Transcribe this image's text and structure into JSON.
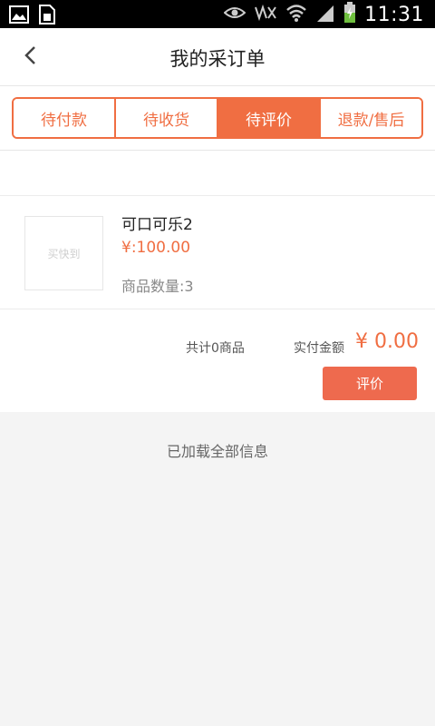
{
  "status_bar": {
    "time": "11:31",
    "icons": [
      "image-icon",
      "sim-card-icon",
      "eye-icon",
      "mute-icon",
      "wifi-icon",
      "signal-icon",
      "battery-charging-icon"
    ]
  },
  "header": {
    "title": "我的采订单",
    "back_icon": "chevron-left-icon"
  },
  "tabs": [
    {
      "label": "待付款",
      "active": false
    },
    {
      "label": "待收货",
      "active": false
    },
    {
      "label": "待评价",
      "active": true
    },
    {
      "label": "退款/售后",
      "active": false
    }
  ],
  "order": {
    "thumbnail_text": "买快到",
    "product_name": "可口可乐2",
    "price": "¥:100.00",
    "quantity": "商品数量:3",
    "total_count": "共计0商品",
    "paid_label": "实付金额",
    "paid_amount": "¥ 0.00",
    "review_button": "评价"
  },
  "footer_message": "已加载全部信息",
  "colors": {
    "accent": "#f06e42",
    "button": "#ee6a4e",
    "page_bg": "#f4f4f4"
  }
}
